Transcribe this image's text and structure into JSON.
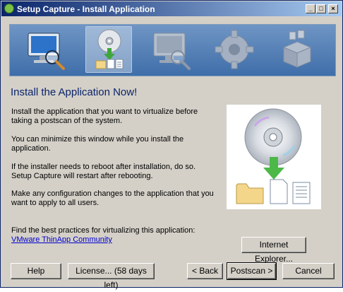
{
  "window": {
    "title": "Setup Capture - Install Application",
    "controls": {
      "minimize": "_",
      "maximize": "□",
      "close": "×"
    }
  },
  "steps": [
    {
      "icon": "monitor-magnifier-icon",
      "state": "inactive-colored"
    },
    {
      "icon": "cd-install-icon",
      "state": "active"
    },
    {
      "icon": "monitor-magnifier-gray-icon",
      "state": "disabled"
    },
    {
      "icon": "gear-icon",
      "state": "disabled"
    },
    {
      "icon": "package-icon",
      "state": "disabled"
    }
  ],
  "content": {
    "heading": "Install the Application Now!",
    "para1": "Install the application that you want to virtualize before taking a postscan of the system.",
    "para2": "You can minimize this window while you install the application.",
    "para3": "If the installer needs to reboot after installation, do so. Setup Capture will restart after rebooting.",
    "para4": "Make any configuration changes to the application that you want to apply to all users.",
    "best_practices": "Find the best practices for virtualizing this application:",
    "community_link": "VMware ThinApp Community"
  },
  "buttons": {
    "internet_explorer": "Internet Explorer...",
    "help": "Help",
    "license": "License... (58 days left)",
    "back": "< Back",
    "postscan": "Postscan >",
    "cancel": "Cancel"
  },
  "colors": {
    "heading": "#0a246a",
    "link": "#0000cc",
    "accent_green": "#4cb848"
  }
}
